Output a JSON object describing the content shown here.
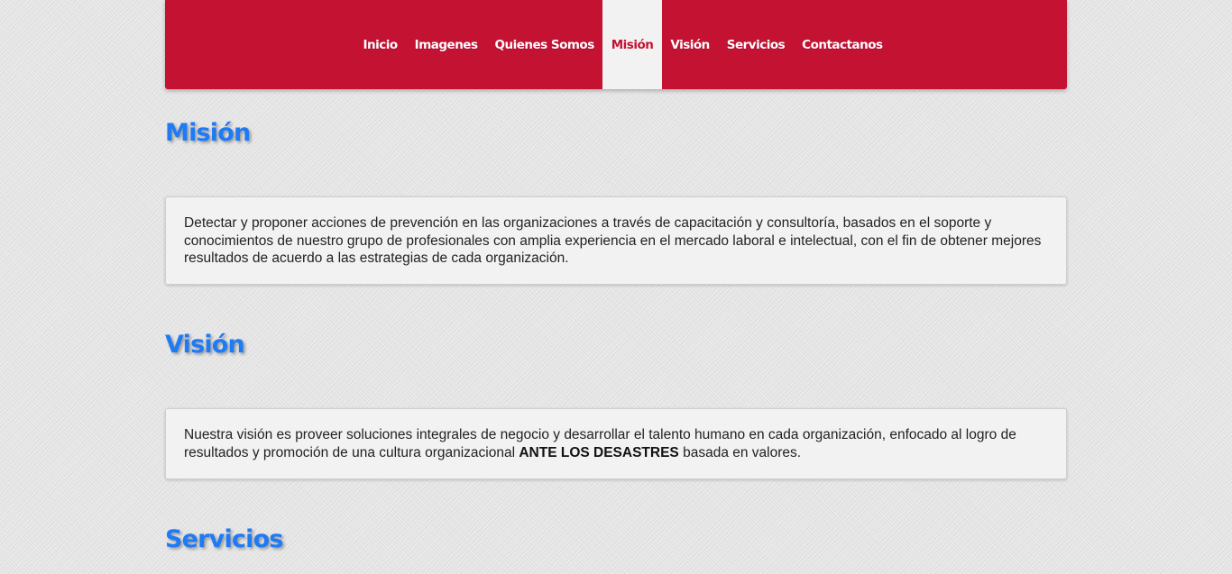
{
  "nav": {
    "items": [
      {
        "label": "Inicio",
        "active": false
      },
      {
        "label": "Imagenes",
        "active": false
      },
      {
        "label": "Quienes Somos",
        "active": false
      },
      {
        "label": "Misión",
        "active": true
      },
      {
        "label": "Visión",
        "active": false
      },
      {
        "label": "Servicios",
        "active": false
      },
      {
        "label": "Contactanos",
        "active": false
      }
    ]
  },
  "mision": {
    "title": "Misión",
    "text": "Detectar y proponer acciones de prevención en las organizaciones a través de capacitación y consultoría, basados en el soporte y conocimientos de nuestro grupo de profesionales con amplia experiencia en el mercado laboral e intelectual, con el fin de obtener mejores resultados de acuerdo a las estrategias de cada organización."
  },
  "vision": {
    "title": "Visión",
    "text_before": "Nuestra visión es proveer soluciones integrales de negocio y desarrollar el talento humano en cada organización, enfocado al logro de resultados y promoción de una cultura organizacional ",
    "text_bold": "ANTE LOS DESASTRES",
    "text_after": " basada en valores."
  },
  "servicios": {
    "title": "Servicios"
  },
  "colors": {
    "nav_background": "#c41233",
    "active_tab_background": "#f2f2f2",
    "heading": "#1e7bf5",
    "card_background": "#f2f2f2"
  }
}
